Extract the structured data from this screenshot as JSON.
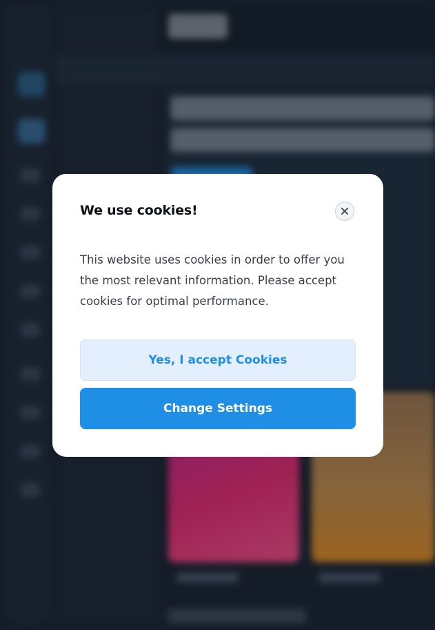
{
  "cookie_modal": {
    "title": "We use cookies!",
    "body": "This website uses cookies in order to offer you the most relevant information. Please accept cookies for optimal performance.",
    "accept_label": "Yes, I accept Cookies",
    "settings_label": "Change Settings",
    "close_icon": "close-icon"
  },
  "colors": {
    "accent": "#1f8fe6",
    "accept_bg": "#e3effd",
    "modal_bg": "#ffffff",
    "backdrop": "#1a2330"
  }
}
